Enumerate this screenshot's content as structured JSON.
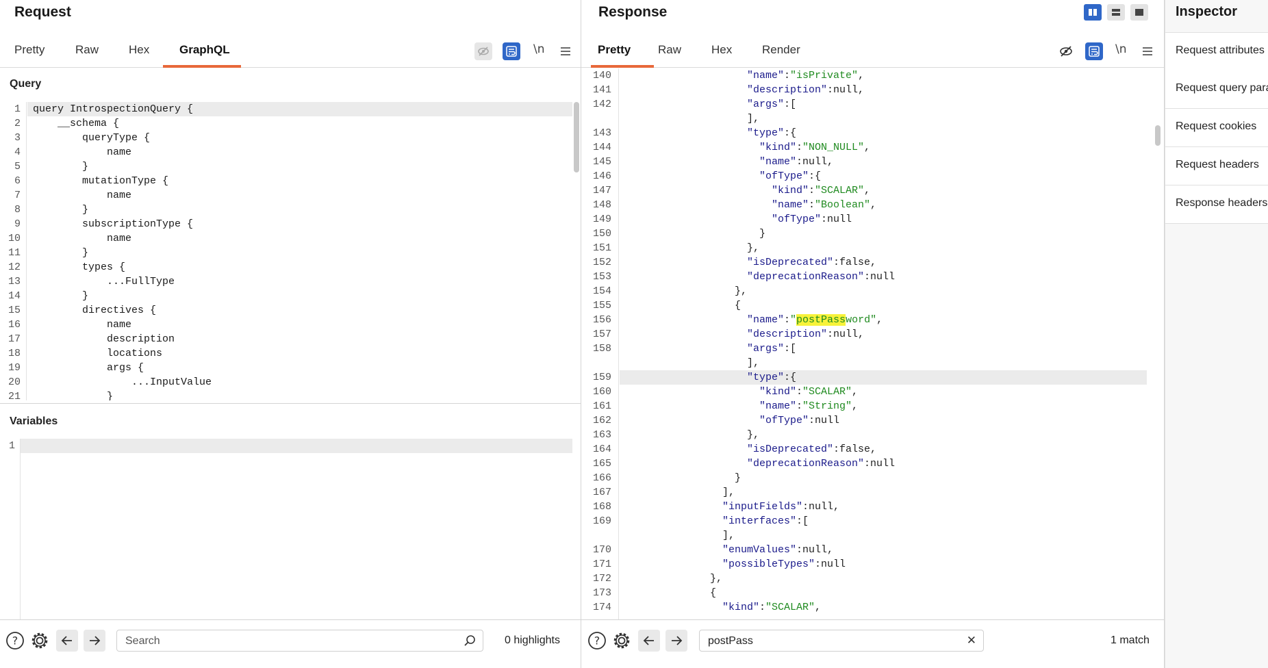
{
  "request": {
    "title": "Request",
    "tabs": [
      "Pretty",
      "Raw",
      "Hex",
      "GraphQL"
    ],
    "active_tab": "GraphQL",
    "newline_label": "\\n",
    "query_label": "Query",
    "variables_label": "Variables",
    "query_lines": [
      {
        "n": "1",
        "text": "query IntrospectionQuery {"
      },
      {
        "n": "2",
        "text": "    __schema {"
      },
      {
        "n": "3",
        "text": "        queryType {"
      },
      {
        "n": "4",
        "text": "            name"
      },
      {
        "n": "5",
        "text": "        }"
      },
      {
        "n": "6",
        "text": "        mutationType {"
      },
      {
        "n": "7",
        "text": "            name"
      },
      {
        "n": "8",
        "text": "        }"
      },
      {
        "n": "9",
        "text": "        subscriptionType {"
      },
      {
        "n": "10",
        "text": "            name"
      },
      {
        "n": "11",
        "text": "        }"
      },
      {
        "n": "12",
        "text": "        types {"
      },
      {
        "n": "13",
        "text": "            ...FullType"
      },
      {
        "n": "14",
        "text": "        }"
      },
      {
        "n": "15",
        "text": "        directives {"
      },
      {
        "n": "16",
        "text": "            name"
      },
      {
        "n": "17",
        "text": "            description"
      },
      {
        "n": "18",
        "text": "            locations"
      },
      {
        "n": "19",
        "text": "            args {"
      },
      {
        "n": "20",
        "text": "                ...InputValue"
      },
      {
        "n": "21",
        "text": "            }"
      }
    ],
    "variables_lines": [
      {
        "n": "1",
        "text": ""
      }
    ],
    "search_placeholder": "Search",
    "search_value": "",
    "highlights_text": "0 highlights"
  },
  "response": {
    "title": "Response",
    "tabs": [
      "Pretty",
      "Raw",
      "Hex",
      "Render"
    ],
    "active_tab": "Pretty",
    "newline_label": "\\n",
    "lines": [
      {
        "n": "140",
        "indent": 20,
        "parts": [
          [
            "k",
            "\"name\""
          ],
          [
            "p",
            ":"
          ],
          [
            "s",
            "\"isPrivate\""
          ],
          [
            "p",
            ","
          ]
        ]
      },
      {
        "n": "141",
        "indent": 20,
        "parts": [
          [
            "k",
            "\"description\""
          ],
          [
            "p",
            ":null,"
          ]
        ]
      },
      {
        "n": "142",
        "indent": 20,
        "parts": [
          [
            "k",
            "\"args\""
          ],
          [
            "p",
            ":["
          ]
        ]
      },
      {
        "n": "",
        "indent": 20,
        "parts": [
          [
            "p",
            "],"
          ]
        ]
      },
      {
        "n": "143",
        "indent": 20,
        "parts": [
          [
            "k",
            "\"type\""
          ],
          [
            "p",
            ":{"
          ]
        ]
      },
      {
        "n": "144",
        "indent": 22,
        "parts": [
          [
            "k",
            "\"kind\""
          ],
          [
            "p",
            ":"
          ],
          [
            "s",
            "\"NON_NULL\""
          ],
          [
            "p",
            ","
          ]
        ]
      },
      {
        "n": "145",
        "indent": 22,
        "parts": [
          [
            "k",
            "\"name\""
          ],
          [
            "p",
            ":null,"
          ]
        ]
      },
      {
        "n": "146",
        "indent": 22,
        "parts": [
          [
            "k",
            "\"ofType\""
          ],
          [
            "p",
            ":{"
          ]
        ]
      },
      {
        "n": "147",
        "indent": 24,
        "parts": [
          [
            "k",
            "\"kind\""
          ],
          [
            "p",
            ":"
          ],
          [
            "s",
            "\"SCALAR\""
          ],
          [
            "p",
            ","
          ]
        ]
      },
      {
        "n": "148",
        "indent": 24,
        "parts": [
          [
            "k",
            "\"name\""
          ],
          [
            "p",
            ":"
          ],
          [
            "s",
            "\"Boolean\""
          ],
          [
            "p",
            ","
          ]
        ]
      },
      {
        "n": "149",
        "indent": 24,
        "parts": [
          [
            "k",
            "\"ofType\""
          ],
          [
            "p",
            ":null"
          ]
        ]
      },
      {
        "n": "150",
        "indent": 22,
        "parts": [
          [
            "p",
            "}"
          ]
        ]
      },
      {
        "n": "151",
        "indent": 20,
        "parts": [
          [
            "p",
            "},"
          ]
        ]
      },
      {
        "n": "152",
        "indent": 20,
        "parts": [
          [
            "k",
            "\"isDeprecated\""
          ],
          [
            "p",
            ":false,"
          ]
        ]
      },
      {
        "n": "153",
        "indent": 20,
        "parts": [
          [
            "k",
            "\"deprecationReason\""
          ],
          [
            "p",
            ":null"
          ]
        ]
      },
      {
        "n": "154",
        "indent": 18,
        "parts": [
          [
            "p",
            "},"
          ]
        ]
      },
      {
        "n": "155",
        "indent": 18,
        "parts": [
          [
            "p",
            "{"
          ]
        ]
      },
      {
        "n": "156",
        "indent": 20,
        "parts": [
          [
            "k",
            "\"name\""
          ],
          [
            "p",
            ":"
          ],
          [
            "s",
            "\""
          ],
          [
            "m",
            "postPass"
          ],
          [
            "s",
            "word\""
          ],
          [
            "p",
            ","
          ]
        ]
      },
      {
        "n": "157",
        "indent": 20,
        "parts": [
          [
            "k",
            "\"description\""
          ],
          [
            "p",
            ":null,"
          ]
        ]
      },
      {
        "n": "158",
        "indent": 20,
        "parts": [
          [
            "k",
            "\"args\""
          ],
          [
            "p",
            ":["
          ]
        ]
      },
      {
        "n": "",
        "indent": 20,
        "parts": [
          [
            "p",
            "],"
          ]
        ]
      },
      {
        "n": "159",
        "indent": 20,
        "parts": [
          [
            "k",
            "\"type\""
          ],
          [
            "p",
            ":{"
          ]
        ],
        "current": true
      },
      {
        "n": "160",
        "indent": 22,
        "parts": [
          [
            "k",
            "\"kind\""
          ],
          [
            "p",
            ":"
          ],
          [
            "s",
            "\"SCALAR\""
          ],
          [
            "p",
            ","
          ]
        ]
      },
      {
        "n": "161",
        "indent": 22,
        "parts": [
          [
            "k",
            "\"name\""
          ],
          [
            "p",
            ":"
          ],
          [
            "s",
            "\"String\""
          ],
          [
            "p",
            ","
          ]
        ]
      },
      {
        "n": "162",
        "indent": 22,
        "parts": [
          [
            "k",
            "\"ofType\""
          ],
          [
            "p",
            ":null"
          ]
        ]
      },
      {
        "n": "163",
        "indent": 20,
        "parts": [
          [
            "p",
            "},"
          ]
        ]
      },
      {
        "n": "164",
        "indent": 20,
        "parts": [
          [
            "k",
            "\"isDeprecated\""
          ],
          [
            "p",
            ":false,"
          ]
        ]
      },
      {
        "n": "165",
        "indent": 20,
        "parts": [
          [
            "k",
            "\"deprecationReason\""
          ],
          [
            "p",
            ":null"
          ]
        ]
      },
      {
        "n": "166",
        "indent": 18,
        "parts": [
          [
            "p",
            "}"
          ]
        ]
      },
      {
        "n": "167",
        "indent": 16,
        "parts": [
          [
            "p",
            "],"
          ]
        ]
      },
      {
        "n": "168",
        "indent": 16,
        "parts": [
          [
            "k",
            "\"inputFields\""
          ],
          [
            "p",
            ":null,"
          ]
        ]
      },
      {
        "n": "169",
        "indent": 16,
        "parts": [
          [
            "k",
            "\"interfaces\""
          ],
          [
            "p",
            ":["
          ]
        ]
      },
      {
        "n": "",
        "indent": 16,
        "parts": [
          [
            "p",
            "],"
          ]
        ]
      },
      {
        "n": "170",
        "indent": 16,
        "parts": [
          [
            "k",
            "\"enumValues\""
          ],
          [
            "p",
            ":null,"
          ]
        ]
      },
      {
        "n": "171",
        "indent": 16,
        "parts": [
          [
            "k",
            "\"possibleTypes\""
          ],
          [
            "p",
            ":null"
          ]
        ]
      },
      {
        "n": "172",
        "indent": 14,
        "parts": [
          [
            "p",
            "},"
          ]
        ]
      },
      {
        "n": "173",
        "indent": 14,
        "parts": [
          [
            "p",
            "{"
          ]
        ]
      },
      {
        "n": "174",
        "indent": 16,
        "parts": [
          [
            "k",
            "\"kind\""
          ],
          [
            "p",
            ":"
          ],
          [
            "s",
            "\"SCALAR\""
          ],
          [
            "p",
            ","
          ]
        ]
      }
    ],
    "search_value": "postPass",
    "match_text": "1 match"
  },
  "inspector": {
    "title": "Inspector",
    "items": [
      "Request attributes",
      "Request query parameters",
      "Request cookies",
      "Request headers",
      "Response headers"
    ]
  },
  "colors": {
    "accent": "#e8683a",
    "blue": "#2f67c8",
    "highlight": "#f7f23a"
  }
}
